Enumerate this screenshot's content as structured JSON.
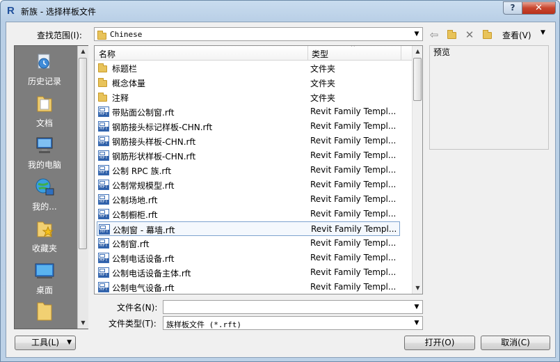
{
  "window": {
    "title": "新族 - 选择样板文件",
    "app_icon_letter": "R",
    "help_label": "?",
    "close_label": "✕"
  },
  "lookin": {
    "label": "查找范围(I):",
    "value": "Chinese"
  },
  "toolbar": {
    "view_label": "查看(V)"
  },
  "places": [
    {
      "label": "历史记录",
      "icon": "history-icon"
    },
    {
      "label": "文档",
      "icon": "documents-icon"
    },
    {
      "label": "我的电脑",
      "icon": "computer-icon"
    },
    {
      "label": "我的...",
      "icon": "network-icon"
    },
    {
      "label": "收藏夹",
      "icon": "favorites-icon"
    },
    {
      "label": "桌面",
      "icon": "desktop-icon"
    },
    {
      "label": "",
      "icon": "folder-icon"
    }
  ],
  "filelist": {
    "columns": {
      "name": "名称",
      "type": "类型"
    },
    "rows": [
      {
        "name": "标题栏",
        "type": "文件夹",
        "kind": "folder"
      },
      {
        "name": "概念体量",
        "type": "文件夹",
        "kind": "folder"
      },
      {
        "name": "注释",
        "type": "文件夹",
        "kind": "folder"
      },
      {
        "name": "带贴面公制窗.rft",
        "type": "Revit Family Templ...",
        "kind": "rft"
      },
      {
        "name": "钢筋接头标记样板-CHN.rft",
        "type": "Revit Family Templ...",
        "kind": "rft"
      },
      {
        "name": "钢筋接头样板-CHN.rft",
        "type": "Revit Family Templ...",
        "kind": "rft"
      },
      {
        "name": "钢筋形状样板-CHN.rft",
        "type": "Revit Family Templ...",
        "kind": "rft"
      },
      {
        "name": "公制 RPC 族.rft",
        "type": "Revit Family Templ...",
        "kind": "rft"
      },
      {
        "name": "公制常规模型.rft",
        "type": "Revit Family Templ...",
        "kind": "rft"
      },
      {
        "name": "公制场地.rft",
        "type": "Revit Family Templ...",
        "kind": "rft"
      },
      {
        "name": "公制橱柜.rft",
        "type": "Revit Family Templ...",
        "kind": "rft"
      },
      {
        "name": "公制窗 - 幕墙.rft",
        "type": "Revit Family Templ...",
        "kind": "rft",
        "selected": true
      },
      {
        "name": "公制窗.rft",
        "type": "Revit Family Templ...",
        "kind": "rft"
      },
      {
        "name": "公制电话设备.rft",
        "type": "Revit Family Templ...",
        "kind": "rft"
      },
      {
        "name": "公制电话设备主体.rft",
        "type": "Revit Family Templ...",
        "kind": "rft"
      },
      {
        "name": "公制电气设备.rft",
        "type": "Revit Family Templ...",
        "kind": "rft"
      }
    ]
  },
  "preview": {
    "label": "预览"
  },
  "filename": {
    "label": "文件名(N):",
    "value": ""
  },
  "filetype": {
    "label": "文件类型(T):",
    "value": "族样板文件 (*.rft)"
  },
  "buttons": {
    "tools": "工具(L)",
    "open": "打开(O)",
    "cancel": "取消(C)"
  }
}
